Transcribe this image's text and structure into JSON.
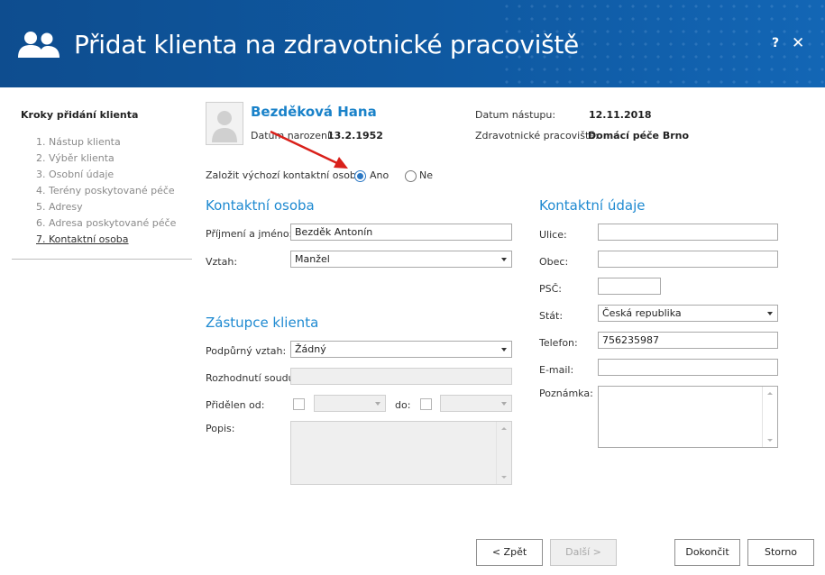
{
  "header": {
    "title": "Přidat klienta na zdravotnické pracoviště",
    "icon": "users-icon",
    "help_label": "?",
    "close_label": "✕",
    "bg_color": "#0e4d8f"
  },
  "steps": {
    "title": "Kroky přidání klienta",
    "items": [
      {
        "label": "1. Nástup klienta"
      },
      {
        "label": "2. Výběr klienta"
      },
      {
        "label": "3. Osobní údaje"
      },
      {
        "label": "4. Terény poskytované péče"
      },
      {
        "label": "5. Adresy"
      },
      {
        "label": "6. Adresa poskytované péče"
      },
      {
        "label": "7. Kontaktní osoba",
        "active": true
      }
    ]
  },
  "client": {
    "name": "Bezděková Hana",
    "dob_label": "Datum narození:",
    "dob": "13.2.1952",
    "start_label": "Datum nástupu:",
    "start_date": "12.11.2018",
    "workplace_label": "Zdravotnické pracoviště:",
    "workplace": "Domácí péče Brno"
  },
  "default_contact": {
    "question": "Založit výchozí kontaktní osobu:",
    "yes_label": "Ano",
    "no_label": "Ne",
    "selected": "Ano"
  },
  "contact_person": {
    "heading": "Kontaktní osoba",
    "name_label": "Příjmení a jméno:",
    "name_value": "Bezděk Antonín",
    "relation_label": "Vztah:",
    "relation_value": "Manžel"
  },
  "representative": {
    "heading": "Zástupce klienta",
    "support_label": "Podpůrný vztah:",
    "support_value": "Žádný",
    "court_label": "Rozhodnutí soudu:",
    "court_value": "",
    "assigned_from_label": "Přidělen od:",
    "to_label": "do:",
    "description_label": "Popis:"
  },
  "contact_details": {
    "heading": "Kontaktní údaje",
    "street_label": "Ulice:",
    "street_value": "",
    "city_label": "Obec:",
    "city_value": "",
    "zip_label": "PSČ:",
    "zip_value": "",
    "country_label": "Stát:",
    "country_value": "Česká republika",
    "phone_label": "Telefon:",
    "phone_value": "756235987",
    "email_label": "E-mail:",
    "email_value": "",
    "note_label": "Poznámka:"
  },
  "buttons": {
    "back": "< Zpět",
    "next": "Další >",
    "finish": "Dokončit",
    "cancel": "Storno"
  },
  "colors": {
    "accent": "#1f8ad1",
    "arrow": "#d9201a"
  }
}
